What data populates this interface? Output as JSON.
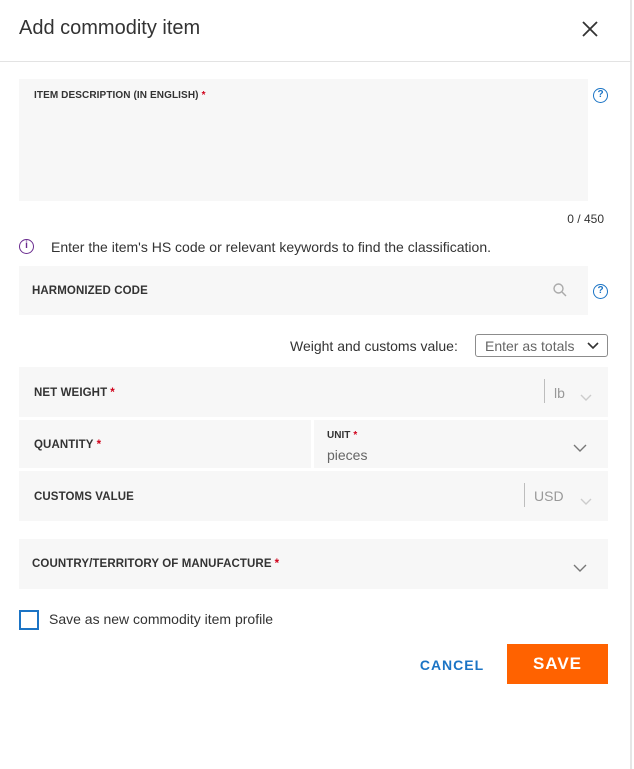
{
  "header": {
    "title": "Add commodity item"
  },
  "description": {
    "label": "ITEM DESCRIPTION (IN ENGLISH)",
    "required_mark": "*",
    "counter": "0 / 450"
  },
  "info": {
    "text": "Enter the item's HS code or relevant keywords to find the classification."
  },
  "harmonized": {
    "label": "HARMONIZED CODE"
  },
  "weight_customs": {
    "label": "Weight and customs value:",
    "selected": "Enter as totals"
  },
  "net_weight": {
    "label": "NET WEIGHT",
    "required_mark": "*",
    "unit": "lb"
  },
  "quantity": {
    "label": "QUANTITY",
    "required_mark": "*",
    "unit_label": "UNIT",
    "unit_required_mark": "*",
    "unit_value": "pieces"
  },
  "customs_value": {
    "label": "CUSTOMS VALUE",
    "currency": "USD"
  },
  "country": {
    "label": "COUNTRY/TERRITORY OF MANUFACTURE",
    "required_mark": "*"
  },
  "profile": {
    "label": "Save as new commodity item profile"
  },
  "actions": {
    "cancel": "CANCEL",
    "save": "SAVE"
  },
  "icons": {
    "help": "?",
    "info": "i"
  },
  "colors": {
    "accent": "#1b74c5",
    "primary_button": "#ff6200",
    "required": "#d0021b",
    "info": "#6a2c8f",
    "field_bg": "#f7f7f7"
  }
}
